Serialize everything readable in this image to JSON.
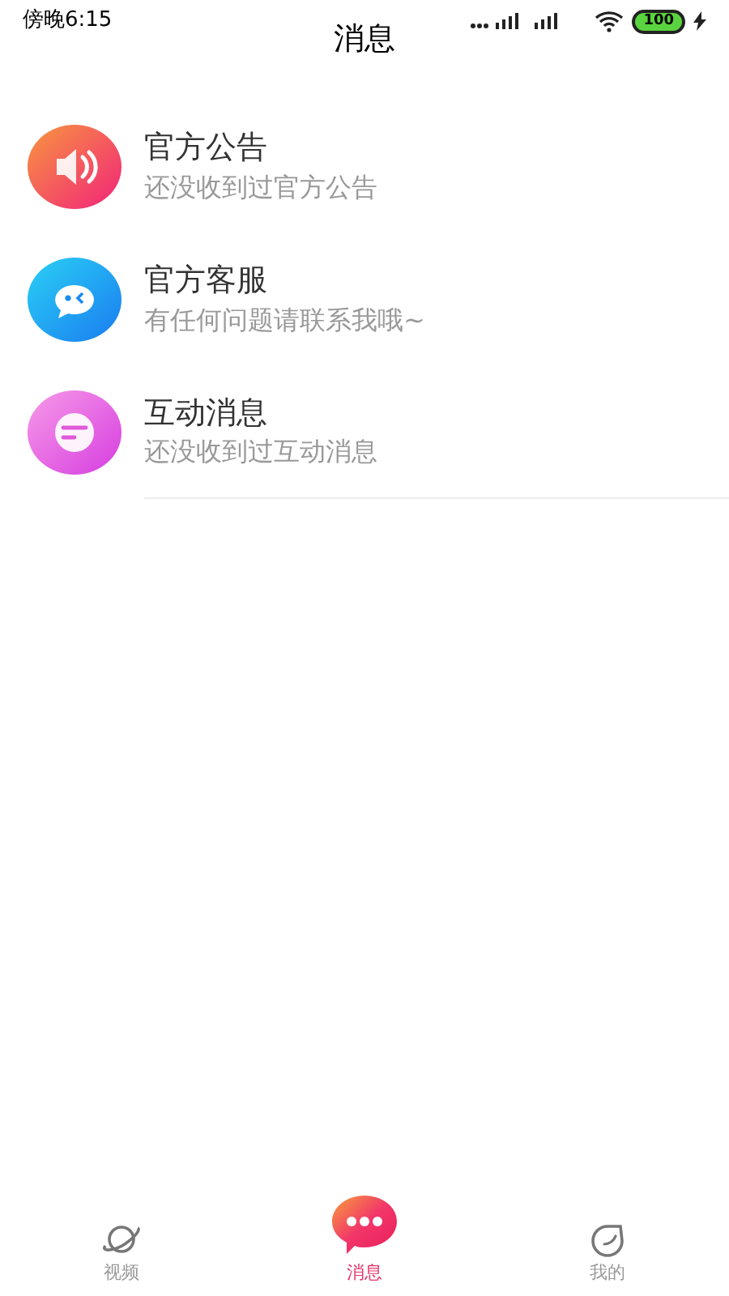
{
  "status_bar": {
    "time": "傍晚6:15",
    "battery": "100"
  },
  "header": {
    "title": "消息"
  },
  "messages": [
    {
      "kind": "announcement",
      "title": "官方公告",
      "subtitle": "还没收到过官方公告"
    },
    {
      "kind": "service",
      "title": "官方客服",
      "subtitle": "有任何问题请联系我哦~"
    },
    {
      "kind": "interaction",
      "title": "互动消息",
      "subtitle": "还没收到过互动消息"
    }
  ],
  "tabs": [
    {
      "kind": "video",
      "label": "视频",
      "selected": false
    },
    {
      "kind": "messages",
      "label": "消息",
      "selected": true
    },
    {
      "kind": "profile",
      "label": "我的",
      "selected": false
    }
  ]
}
